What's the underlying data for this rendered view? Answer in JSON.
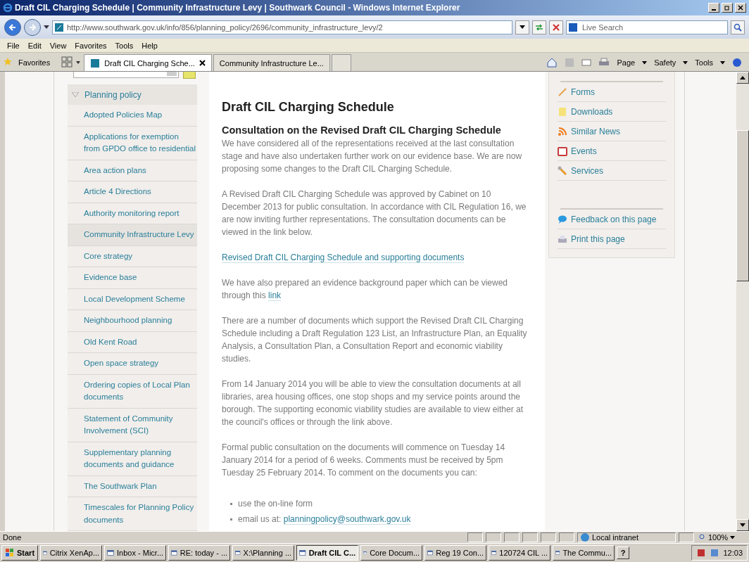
{
  "window": {
    "title": "Draft CIL Charging Schedule | Community Infrastructure Levy | Southwark Council - Windows Internet Explorer"
  },
  "address_bar": {
    "url": "http://www.southwark.gov.uk/info/856/planning_policy/2696/community_infrastructure_levy/2"
  },
  "search": {
    "placeholder": "Live Search"
  },
  "menu": [
    "File",
    "Edit",
    "View",
    "Favorites",
    "Tools",
    "Help"
  ],
  "favorites": "Favorites",
  "tabs": [
    {
      "label": "Draft CIL Charging Sche...",
      "selected": true
    },
    {
      "label": "Community Infrastructure Le...",
      "selected": false
    }
  ],
  "command_bar": [
    "Page",
    "Safety",
    "Tools"
  ],
  "page": {
    "nav_section": {
      "label": "Planning policy",
      "expanded": true
    },
    "nav_items": [
      {
        "label": "Adopted Policies Map",
        "selected": false
      },
      {
        "label": "Applications for exemption from GPDO office to residential",
        "selected": false
      },
      {
        "label": "Area action plans",
        "selected": false
      },
      {
        "label": "Article 4 Directions",
        "selected": false
      },
      {
        "label": "Authority monitoring report",
        "selected": false
      },
      {
        "label": "Community Infrastructure Levy",
        "selected": true
      },
      {
        "label": "Core strategy",
        "selected": false
      },
      {
        "label": "Evidence base",
        "selected": false
      },
      {
        "label": "Local Development Scheme",
        "selected": false
      },
      {
        "label": "Neighbourhood planning",
        "selected": false
      },
      {
        "label": "Old Kent Road",
        "selected": false
      },
      {
        "label": "Open space strategy",
        "selected": false
      },
      {
        "label": "Ordering copies of Local Plan documents",
        "selected": false
      },
      {
        "label": "Statement of Community Involvement (SCI)",
        "selected": false
      },
      {
        "label": "Supplementary planning documents and guidance",
        "selected": false
      },
      {
        "label": "The Southwark Plan",
        "selected": false
      },
      {
        "label": "Timescales for Planning Policy documents",
        "selected": false
      }
    ],
    "heading": "Draft CIL Charging Schedule",
    "subheading": "Consultation on the Revised Draft CIL Charging Schedule",
    "blocks": [
      {
        "kind": "paragraph",
        "text": "We have considered all of the representations received at the last consultation stage and have also undertaken further work on our evidence base.  We are now proposing some changes to the Draft CIL Charging Schedule."
      },
      {
        "kind": "paragraph",
        "text": "A Revised Draft CIL Charging Schedule was approved by Cabinet on 10 December 2013 for public consultation.  In accordance with CIL Regulation 16, we are now inviting further representations. The consultation documents can be viewed in the link below."
      },
      {
        "kind": "link",
        "text": "Revised Draft CIL Charging Schedule and supporting documents"
      },
      {
        "kind": "paragraph",
        "text": "We have also prepared an evidence background paper which can be viewed through this ",
        "link": "link"
      },
      {
        "kind": "paragraph",
        "text": "There are a number of documents which support the Revised Draft CIL Charging Schedule including a Draft Regulation 123 List, an Infrastructure Plan, an Equality Analysis, a Consultation Plan, a Consultation Report and economic viability studies."
      },
      {
        "kind": "paragraph",
        "text": "From 14 January 2014 you will be able to view the consultation documents at all libraries, area housing offices, one stop shops and my service points around the borough. The supporting economic viability studies are available to view either at the council's offices or through the link above."
      },
      {
        "kind": "paragraph",
        "text": "Formal public consultation on the documents will commence on Tuesday 14 January 2014 for a period of 6 weeks. Comments must be received by 5pm Tuesday 25 February 2014.  To comment on the documents you can:"
      }
    ],
    "bullets": [
      {
        "text": "use the on-line form"
      },
      {
        "text": "email us at: ",
        "link": "planningpolicy@southwark.gov.uk"
      }
    ],
    "sidebar_groups": [
      [
        {
          "label": "Forms",
          "kind": "pencil"
        },
        {
          "label": "Downloads",
          "kind": "note"
        },
        {
          "label": "Similar News",
          "kind": "rss"
        },
        {
          "label": "Events",
          "kind": "calendar"
        },
        {
          "label": "Services",
          "kind": "wrench"
        }
      ],
      [
        {
          "label": "Feedback on this page",
          "kind": "bubble"
        },
        {
          "label": "Print this page",
          "kind": "printer"
        }
      ]
    ]
  },
  "status_bar": {
    "text": "Done",
    "zone": "Local intranet",
    "zoom": "100%"
  },
  "taskbar": {
    "start": "Start",
    "items": [
      {
        "label": "Citrix XenAp...",
        "selected": false
      },
      {
        "label": "Inbox - Micr...",
        "selected": false
      },
      {
        "label": "RE: today - ...",
        "selected": false
      },
      {
        "label": "X:\\Planning ...",
        "selected": false
      },
      {
        "label": "Draft CIL C...",
        "selected": true
      },
      {
        "label": "Core Docum...",
        "selected": false
      },
      {
        "label": "Reg 19 Con...",
        "selected": false
      },
      {
        "label": "120724 CIL ...",
        "selected": false
      },
      {
        "label": "The Commu...",
        "selected": false
      }
    ],
    "help": "?",
    "clock": "12:03"
  }
}
